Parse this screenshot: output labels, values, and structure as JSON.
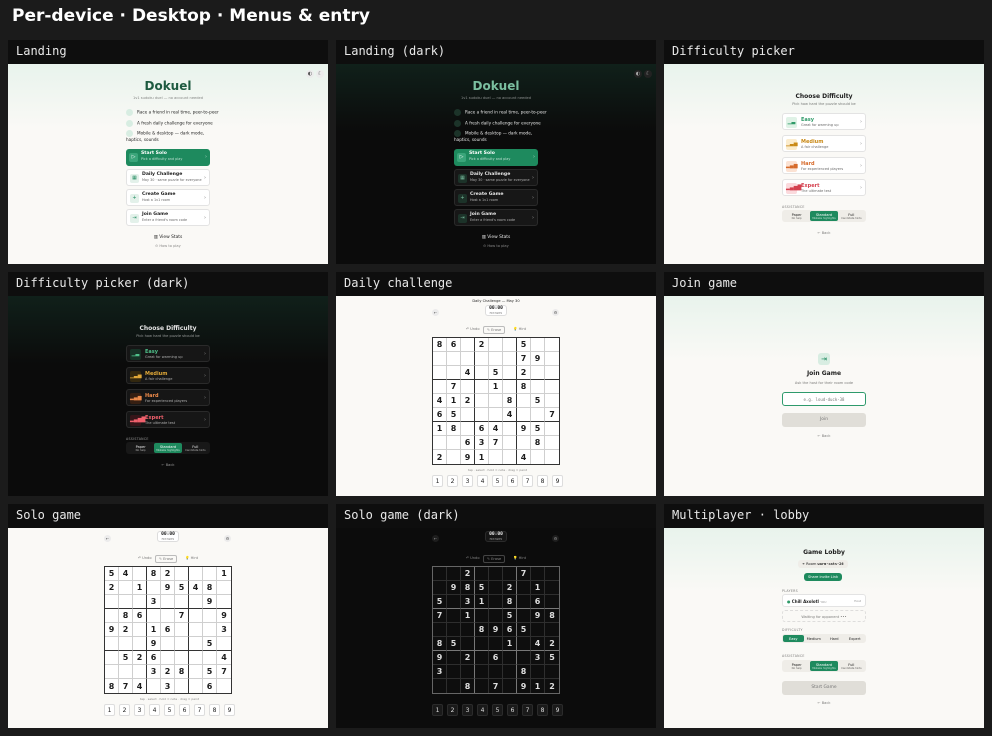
{
  "page_title": "Per-device · Desktop · Menus & entry",
  "panels": {
    "landing": {
      "caption": "Landing",
      "brand": "Dokuel",
      "tagline": "1v1 sudoku duel — no account needed",
      "features": [
        "Race a friend in real time, peer-to-peer",
        "A fresh daily challenge for everyone",
        "Mobile & desktop — dark mode, haptics, sounds"
      ],
      "menu": [
        {
          "title": "Start Solo",
          "sub": "Pick a difficulty and play",
          "icon": "▷"
        },
        {
          "title": "Daily Challenge",
          "sub": "May 30 · same puzzle for everyone",
          "icon": "▦"
        },
        {
          "title": "Create Game",
          "sub": "Host a 1v1 room",
          "icon": "+"
        },
        {
          "title": "Join Game",
          "sub": "Enter a friend's room code",
          "icon": "⇥"
        }
      ],
      "view_stats": "View Stats",
      "how_to_play": "How to play"
    },
    "landing_dark": {
      "caption": "Landing (dark)"
    },
    "difficulty": {
      "caption": "Difficulty picker",
      "title": "Choose Difficulty",
      "subtitle": "Pick how hard the puzzle should be",
      "options": [
        {
          "name": "Easy",
          "desc": "Great for warming up",
          "color": "#2f9a68",
          "bg": "#dff2e6"
        },
        {
          "name": "Medium",
          "desc": "A fair challenge",
          "color": "#c98a18",
          "bg": "#fbeccd"
        },
        {
          "name": "Hard",
          "desc": "For experienced players",
          "color": "#d66a2a",
          "bg": "#fbe2d3"
        },
        {
          "name": "Expert",
          "desc": "The ultimate test",
          "color": "#d4414f",
          "bg": "#fbdadd"
        }
      ],
      "assist_label": "ASSISTANCE",
      "assist": [
        {
          "name": "Paper",
          "sub": "No help"
        },
        {
          "name": "Standard",
          "sub": "Mistake highlights"
        },
        {
          "name": "Full",
          "sub": "Candidate hints"
        }
      ],
      "back": "← Back"
    },
    "difficulty_dark": {
      "caption": "Difficulty picker (dark)"
    },
    "daily": {
      "caption": "Daily challenge",
      "header": "Daily Challenge — May 30",
      "timer": "00:00",
      "timer_label": "MISTAKES",
      "tools": [
        "↶ Undo",
        "✎ Erase",
        "💡 Hint"
      ],
      "hint_text": "tap · select · hold = note · drag = paint",
      "grid": [
        "8",
        "6",
        "",
        "2",
        "",
        "",
        "5",
        "",
        "",
        "",
        "",
        "",
        "",
        "",
        "",
        "7",
        "9",
        "",
        "",
        "",
        "4",
        "",
        "5",
        "",
        "2",
        "",
        "",
        "",
        "7",
        "",
        "",
        "1",
        "",
        "8",
        "",
        "",
        "4",
        "1",
        "2",
        "",
        "",
        "8",
        "",
        "5",
        "",
        "6",
        "5",
        "",
        "",
        "",
        "4",
        "",
        "",
        "7",
        "1",
        "8",
        "",
        "6",
        "4",
        "",
        "9",
        "5",
        "",
        "",
        "",
        "6",
        "3",
        "7",
        "",
        "",
        "8",
        "",
        "2",
        "",
        "9",
        "1",
        "",
        "",
        "4",
        "",
        ""
      ]
    },
    "join": {
      "caption": "Join game",
      "title": "Join Game",
      "subtitle": "Ask the host for their room code",
      "placeholder": "e.g. loud-duck-38",
      "button": "Join",
      "back": "← Back"
    },
    "solo": {
      "caption": "Solo game",
      "grid": [
        "5",
        "4",
        "",
        "8",
        "2",
        "",
        "",
        "",
        "1",
        "2",
        "",
        "1",
        "",
        "9",
        "5",
        "4",
        "8",
        "",
        "",
        "",
        "",
        "3",
        "",
        "",
        "",
        "9",
        "",
        "",
        "8",
        "6",
        "",
        "",
        "7",
        "",
        "",
        "9",
        "9",
        "2",
        "",
        "1",
        "6",
        "",
        "",
        "",
        "3",
        "",
        "",
        "",
        "9",
        "",
        "",
        "",
        "5",
        "",
        "",
        "5",
        "2",
        "6",
        "",
        "",
        "",
        "",
        "4",
        "",
        "",
        "",
        "3",
        "2",
        "8",
        "",
        "5",
        "7",
        "8",
        "7",
        "4",
        "",
        "3",
        "",
        "",
        "6",
        ""
      ]
    },
    "solo_dark": {
      "caption": "Solo game (dark)",
      "grid": [
        "",
        "",
        "2",
        "",
        "",
        "",
        "7",
        "",
        "",
        "",
        "9",
        "8",
        "5",
        "",
        "2",
        "",
        "1",
        "",
        "5",
        "",
        "3",
        "1",
        "",
        "8",
        "",
        "6",
        "",
        "7",
        "",
        "1",
        "",
        "",
        "5",
        "",
        "9",
        "8",
        "",
        "",
        "",
        "8",
        "9",
        "6",
        "5",
        "",
        "",
        "8",
        "5",
        "",
        "",
        "",
        "1",
        "",
        "4",
        "2",
        "9",
        "",
        "2",
        "",
        "6",
        "",
        "",
        "3",
        "5",
        "3",
        "",
        "",
        "",
        "",
        "",
        "8",
        "",
        "",
        "",
        "",
        "8",
        "",
        "7",
        "",
        "9",
        "1",
        "2"
      ]
    },
    "numpad": [
      "1",
      "2",
      "3",
      "4",
      "5",
      "6",
      "7",
      "8",
      "9"
    ],
    "lobby": {
      "caption": "Multiplayer · lobby",
      "title": "Game Lobby",
      "room_label": "Room",
      "room_code": "warm-cats-26",
      "share": "Share invite Link",
      "players_label": "PLAYERS",
      "player_name": "Chill Axolotl",
      "player_tag": "YOU",
      "player_status": "Host",
      "waiting": "Waiting for opponent •••",
      "difficulty_label": "DIFFICULTY",
      "difficulties": [
        "Easy",
        "Medium",
        "Hard",
        "Expert"
      ],
      "assist_label": "ASSISTANCE",
      "start": "Start Game",
      "back": "← Back"
    }
  }
}
